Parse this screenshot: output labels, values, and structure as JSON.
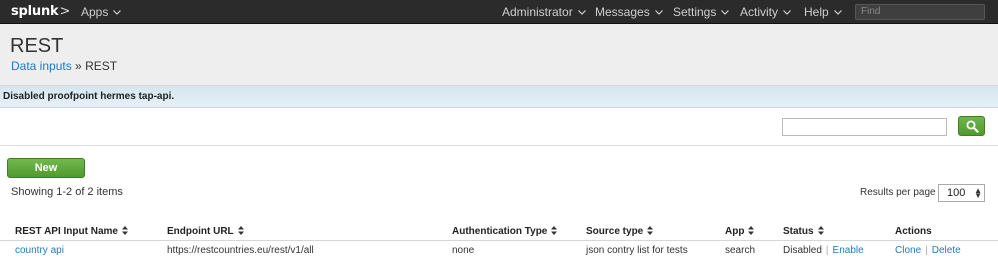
{
  "topbar": {
    "logo_text": "splunk",
    "logo_suffix": ">",
    "apps_label": "Apps",
    "nav": [
      "Administrator",
      "Messages",
      "Settings",
      "Activity",
      "Help"
    ],
    "find_placeholder": "Find"
  },
  "page": {
    "title": "REST",
    "breadcrumb_link": "Data inputs",
    "breadcrumb_sep": "»",
    "breadcrumb_current": "REST"
  },
  "message": "Disabled proofpoint hermes tap-api.",
  "toolbar": {
    "new_label": "New",
    "showing": "Showing 1-2 of 2 items",
    "results_per_page_label": "Results per page",
    "results_per_page_value": "100"
  },
  "table": {
    "headers": [
      "REST API Input Name",
      "Endpoint URL",
      "Authentication Type",
      "Source type",
      "App",
      "Status",
      "Actions"
    ],
    "rows": [
      {
        "name": "country api",
        "endpoint": "https://restcountries.eu/rest/v1/all",
        "auth": "none",
        "sourcetype": "json contry list for tests",
        "app": "search",
        "status": "Disabled",
        "status_action": "Enable",
        "actions": [
          "Clone",
          "Delete"
        ]
      }
    ]
  },
  "colors": {
    "topbar_bg": "#2b2b2b",
    "link": "#1e7bbf",
    "button_green": "#5ba83a",
    "message_bg": "#dbe9f2"
  }
}
